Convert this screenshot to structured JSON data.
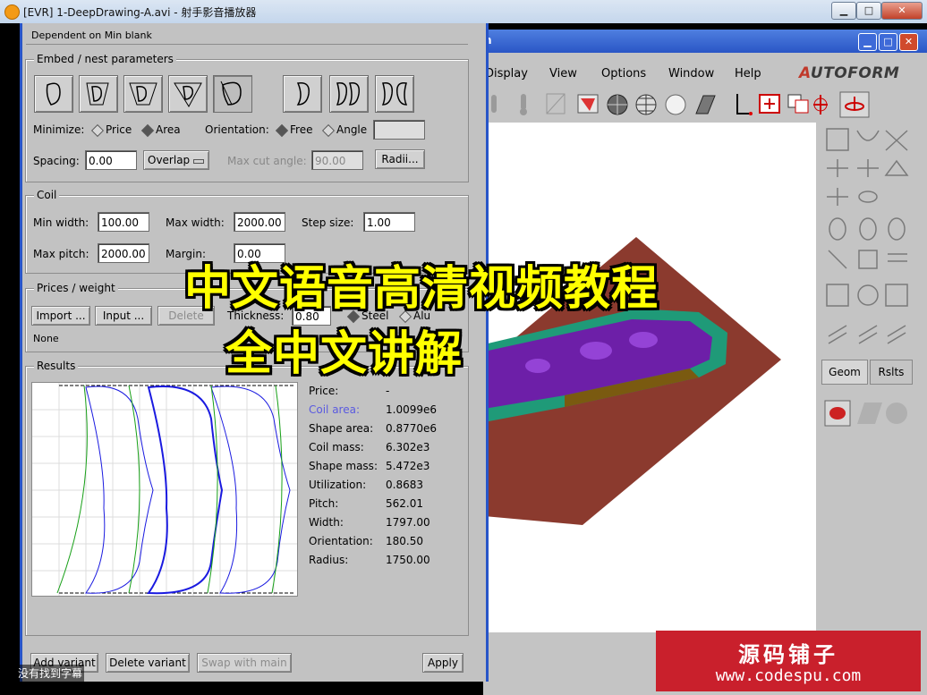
{
  "player": {
    "title": "[EVR] 1-DeepDrawing-A.avi - 射手影音播放器",
    "btn_min": "▁",
    "btn_max": "□",
    "btn_close": "✕"
  },
  "af": {
    "title": "n",
    "menus": [
      "Display",
      "View",
      "Options",
      "Window",
      "Help"
    ],
    "logo_a": "A",
    "logo_rest": "UTOFORM",
    "tabs": {
      "geom": "Geom",
      "rslts": "Rslts"
    }
  },
  "dialog": {
    "top_text": "Dependent on Min blank",
    "embed": {
      "label": "Embed / nest parameters",
      "minimize_label": "Minimize:",
      "price_label": "Price",
      "area_label": "Area",
      "orientation_label": "Orientation:",
      "free_label": "Free",
      "angle_label": "Angle",
      "angle_value": "",
      "spacing_label": "Spacing:",
      "spacing_value": "0.00",
      "overlap_label": "Overlap",
      "max_cut_angle_label": "Max cut angle:",
      "max_cut_angle_value": "90.00",
      "radii_label": "Radii..."
    },
    "coil": {
      "label": "Coil",
      "min_width_label": "Min width:",
      "min_width_value": "100.00",
      "max_width_label": "Max width:",
      "max_width_value": "2000.00",
      "step_size_label": "Step size:",
      "step_size_value": "1.00",
      "max_pitch_label": "Max pitch:",
      "max_pitch_value": "2000.00",
      "margin_label": "Margin:",
      "margin_value": "0.00"
    },
    "prices": {
      "label": "Prices / weight",
      "import_label": "Import ...",
      "input_label": "Input ...",
      "delete_label": "Delete",
      "thickness_label": "Thickness:",
      "thickness_value": "0.80",
      "steel_label": "Steel",
      "alu_label": "Alu",
      "none_text": "None"
    },
    "results": {
      "label": "Results",
      "rows": [
        {
          "key": "Price:",
          "value": "-"
        },
        {
          "key": "Coil area:",
          "value": "1.0099e6"
        },
        {
          "key": "Shape area:",
          "value": "0.8770e6"
        },
        {
          "key": "Coil mass:",
          "value": "6.302e3"
        },
        {
          "key": "Shape mass:",
          "value": "5.472e3"
        },
        {
          "key": "Utilization:",
          "value": "0.8683"
        },
        {
          "key": "Pitch:",
          "value": "562.01"
        },
        {
          "key": "Width:",
          "value": "1797.00"
        },
        {
          "key": "Orientation:",
          "value": "180.50"
        },
        {
          "key": "Radius:",
          "value": "1750.00"
        }
      ],
      "highlight_color": "#5a5ae0"
    },
    "bottom": {
      "add_variant": "Add variant",
      "delete_variant": "Delete variant",
      "swap_with_main": "Swap with main",
      "apply": "Apply"
    }
  },
  "overlay": {
    "line1": "中文语音高清视频教程",
    "line2": "全中文讲解",
    "subtitle_status": "没有找到字幕",
    "watermark_title": "源码铺子",
    "watermark_url": "www.codespu.com"
  }
}
